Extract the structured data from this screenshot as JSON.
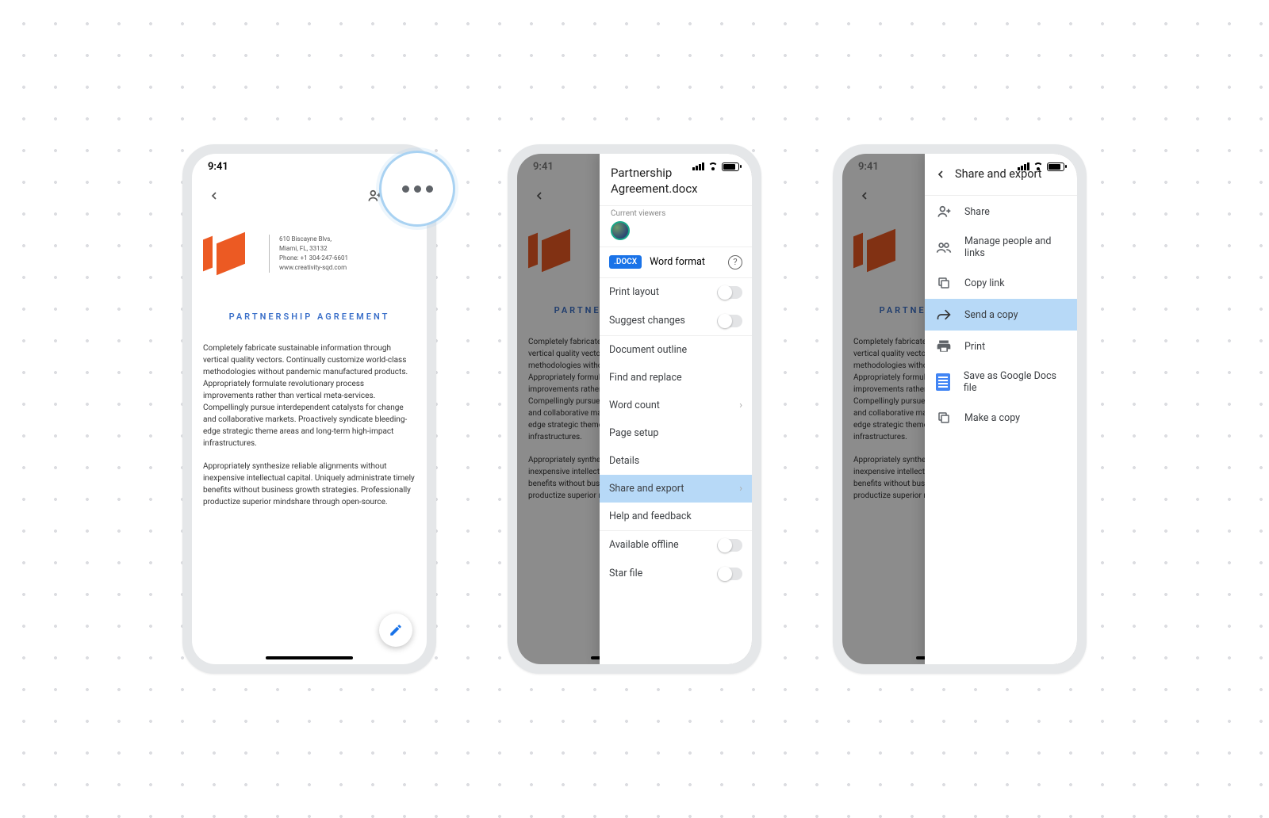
{
  "status_time": "9:41",
  "doc": {
    "addr1": "610 Biscayne Blvs,",
    "addr2": "Miami, FL, 33132",
    "phone": "Phone: +1 304-247-6601",
    "web": "www.creativity-sqd.com",
    "title": "PARTNERSHIP AGREEMENT",
    "p1": "Completely fabricate sustainable information through vertical quality vectors. Continually customize world-class methodologies without pandemic manufactured products. Appropriately formulate revolutionary process improvements rather than vertical meta-services. Compellingly pursue interdependent catalysts for change and collaborative markets. Proactively syndicate bleeding-edge strategic theme areas and long-term high-impact infrastructures.",
    "p2": "Appropriately synthesize reliable alignments without inexpensive intellectual capital. Uniquely administrate timely benefits without business growth strategies. Professionally productize superior mindshare through open-source."
  },
  "options": {
    "filename": "Partnership Agreement.docx",
    "viewers_label": "Current viewers",
    "docx_badge": ".DOCX",
    "format": "Word format",
    "items": {
      "print_layout": "Print layout",
      "suggest": "Suggest changes",
      "outline": "Document outline",
      "find": "Find and replace",
      "wordcount": "Word count",
      "pagesetup": "Page setup",
      "details": "Details",
      "share_export": "Share and export",
      "help": "Help and feedback",
      "offline": "Available offline",
      "star": "Star file"
    }
  },
  "share_export": {
    "title": "Share and export",
    "items": {
      "share": "Share",
      "manage": "Manage people and links",
      "copylink": "Copy link",
      "sendcopy": "Send a copy",
      "print": "Print",
      "saveas": "Save as Google Docs file",
      "makecopy": "Make a copy"
    }
  }
}
